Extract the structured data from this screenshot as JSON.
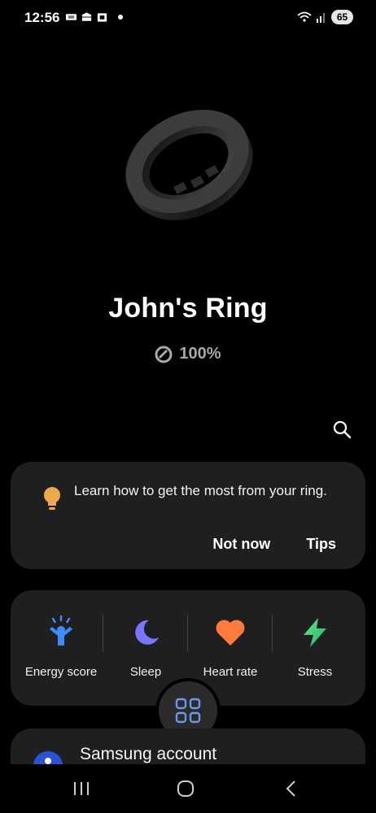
{
  "status_bar": {
    "time": "12:56",
    "battery_level": "65",
    "icons": [
      "ticket-icon",
      "wallet-icon",
      "store-icon",
      "notification-dot",
      "wifi-icon",
      "signal-icon",
      "battery-icon"
    ]
  },
  "device": {
    "name": "John's Ring",
    "battery": "100%"
  },
  "tip": {
    "text": "Learn how to get the most from your ring.",
    "dismiss_label": "Not now",
    "action_label": "Tips",
    "icon": "lightbulb-icon",
    "icon_color": "#f0a94a"
  },
  "features": [
    {
      "label": "Energy score",
      "icon": "energy-score-icon",
      "color": "#3d8bff"
    },
    {
      "label": "Sleep",
      "icon": "moon-icon",
      "color": "#7b74ff"
    },
    {
      "label": "Heart rate",
      "icon": "heart-icon",
      "color": "#ff7a3c"
    },
    {
      "label": "Stress",
      "icon": "bolt-icon",
      "color": "#3ed08b"
    }
  ],
  "account": {
    "label": "Samsung account"
  },
  "fab": {
    "icon": "apps-grid-icon",
    "color": "#6f96e8"
  },
  "nav": {
    "icons": [
      "recent-apps-icon",
      "home-icon",
      "back-icon"
    ]
  }
}
